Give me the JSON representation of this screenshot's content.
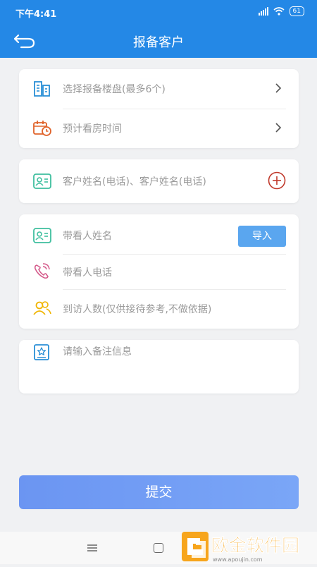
{
  "status_bar": {
    "time": "下午4:41",
    "battery": "61"
  },
  "header": {
    "title": "报备客户"
  },
  "property": {
    "select_building": "选择报备楼盘(最多6个)",
    "visit_time": "预计看房时间"
  },
  "customer": {
    "placeholder": "客户姓名(电话)、客户姓名(电话)"
  },
  "agent": {
    "name_placeholder": "带看人姓名",
    "import_label": "导入",
    "phone_placeholder": "带看人电话",
    "visitors_placeholder": "到访人数(仅供接待参考,不做依据)"
  },
  "remark": {
    "placeholder": "请输入备注信息"
  },
  "submit_label": "提交",
  "watermark": {
    "name": "欧金软件园",
    "url": "www.apoujin.com"
  },
  "colors": {
    "primary": "#2488e6",
    "submit": "#6f9cf4",
    "import": "#5aa6ef",
    "add": "#c0392b"
  }
}
